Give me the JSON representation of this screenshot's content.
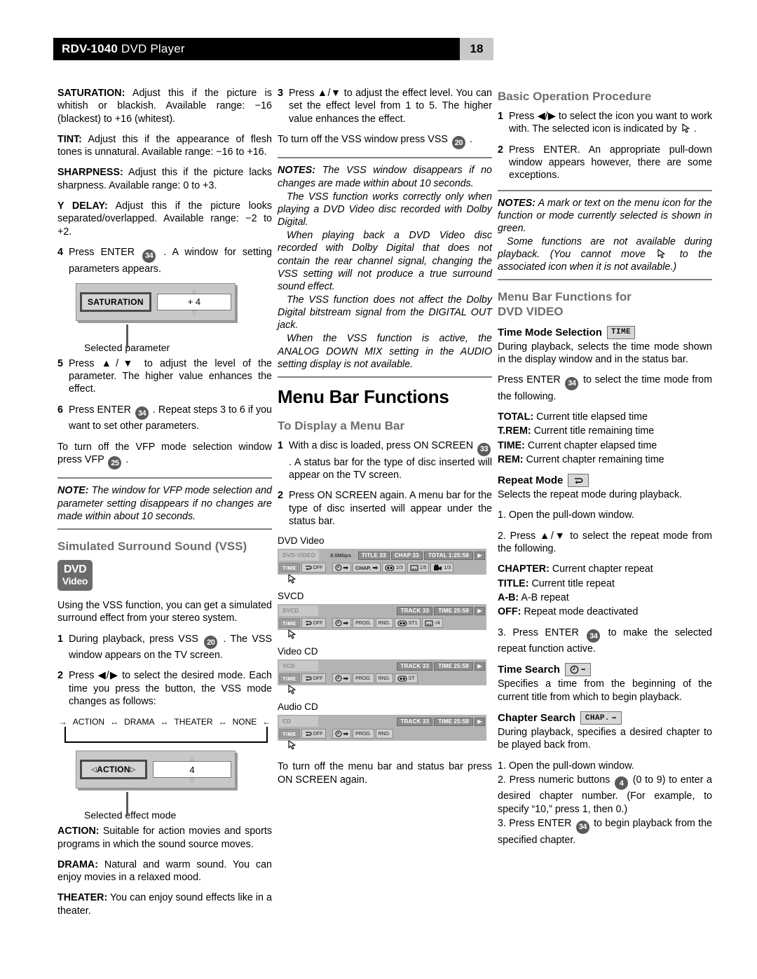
{
  "header": {
    "model": "RDV-1040",
    "product": " DVD Player",
    "page_number": "18"
  },
  "col1": {
    "saturation": {
      "term": "SATURATION:",
      "text": " Adjust this if the picture is whitish or blackish. Available range: −16 (blackest) to +16 (whitest)."
    },
    "tint": {
      "term": "TINT:",
      "text": " Adjust this if the appearance of flesh tones is unnatural. Available range: −16 to +16."
    },
    "sharpness": {
      "term": "SHARPNESS:",
      "text": " Adjust this if the picture lacks sharpness. Available range: 0 to +3."
    },
    "ydelay": {
      "term": "Y DELAY:",
      "text": " Adjust this if the picture looks separated/overlapped. Available range: −2 to +2."
    },
    "step4": {
      "n": "4",
      "pre": "Press ENTER ",
      "key": "34",
      "post": " . A window for setting parameters appears."
    },
    "param_window": {
      "label": "SATURATION",
      "value": "+ 4",
      "caption": "Selected parameter"
    },
    "step5": {
      "n": "5",
      "text": "Press ▲/▼ to adjust the level of the parameter. The higher value enhances the effect."
    },
    "step6": {
      "n": "6",
      "pre": "Press ENTER ",
      "key": "34",
      "post": " . Repeat steps 3 to 6 if you want to set other parameters."
    },
    "vfp_off": {
      "pre": "To turn off the VFP mode selection window press VFP ",
      "key": "25",
      "post": " ."
    },
    "note": {
      "label": "NOTE:",
      "text": " The window for VFP mode selection and parameter setting disappears if no changes are made within about 10 seconds."
    },
    "heading": "Simulated Surround Sound (VSS)",
    "dvd_logo": {
      "line1": "DVD",
      "line2": "Video"
    },
    "intro": "Using the VSS function, you can get a simulated surround effect from your stereo system.",
    "step1": {
      "n": "1",
      "pre": "During playback, press VSS ",
      "key": "20",
      "post": " . The VSS window appears on the TV screen."
    },
    "step2": {
      "n": "2",
      "text": "Press ◀/▶ to select the desired mode. Each time you press the button, the VSS mode changes as follows:"
    },
    "cycle": [
      "ACTION",
      "DRAMA",
      "THEATER",
      "NONE"
    ],
    "effect_window": {
      "label": "ACTION",
      "value": "4",
      "caption": "Selected effect mode"
    },
    "action": {
      "term": "ACTION:",
      "text": " Suitable for action movies and sports programs in which the sound source moves."
    },
    "drama": {
      "term": "DRAMA:",
      "text": " Natural and warm sound. You can enjoy movies in a relaxed mood."
    },
    "theater": {
      "term": "THEATER:",
      "text": " You can enjoy sound effects like in a theater."
    }
  },
  "col2": {
    "step3": {
      "n": "3",
      "text": "Press ▲/▼ to adjust the effect level. You can set the effect level from 1 to 5. The higher value enhances the effect."
    },
    "vss_off": {
      "pre": "To turn off the VSS window press VSS ",
      "key": "20",
      "post": " ."
    },
    "notes": {
      "label": "NOTES:",
      "p1": " The VSS window disappears if no changes are made within about 10 seconds.",
      "p2": "The VSS function works correctly only when playing a DVD Video disc recorded with Dolby Digital.",
      "p3": "When playing back a DVD Video disc recorded with Dolby Digital that does not contain the rear channel signal, changing the VSS setting will not produce a true surround sound effect.",
      "p4": "The VSS function does not affect the Dolby Digital bitstream signal from the DIGITAL OUT jack.",
      "p5": "When the VSS function is active, the ANALOG DOWN MIX setting in the AUDIO setting display is not available."
    },
    "heading": "Menu Bar Functions",
    "subheading": "To Display a Menu Bar",
    "step1": {
      "n": "1",
      "pre": "With a disc is loaded, press ON SCREEN ",
      "key": "33",
      "post": " . A status bar for the type of disc inserted will appear on the TV screen."
    },
    "step2": {
      "n": "2",
      "text": "Press ON SCREEN again. A menu bar for the type of disc inserted will appear under the status bar."
    },
    "statusbars": [
      {
        "title": "DVD Video",
        "disc_type": "DVD-VIDEO",
        "bitrate": "8.5Mbps",
        "chips": [
          "TITLE 33",
          "CHAP 33",
          "TOTAL 1:25:58"
        ],
        "play_icon": "play-icon",
        "buttons": [
          {
            "icon": "time-icon",
            "label": "TIME",
            "active": true
          },
          {
            "icon": "repeat-icon",
            "label": "OFF"
          },
          {
            "icon": "time-search-icon",
            "label": ""
          },
          {
            "icon": "chapter-search-icon",
            "label": "CHAP."
          },
          {
            "icon": "audio-icon",
            "label": "1/3"
          },
          {
            "icon": "subtitle-icon",
            "label": "1/5"
          },
          {
            "icon": "angle-icon",
            "label": "1/3"
          }
        ]
      },
      {
        "title": "SVCD",
        "disc_type": "SVCD",
        "bitrate": "",
        "chips": [
          "TRACK 33",
          "TIME      25:58"
        ],
        "play_icon": "play-icon",
        "buttons": [
          {
            "icon": "time-icon",
            "label": "TIME",
            "active": true
          },
          {
            "icon": "repeat-icon",
            "label": "OFF"
          },
          {
            "icon": "time-search-icon",
            "label": ""
          },
          {
            "icon": "program-icon",
            "label": "PROG."
          },
          {
            "icon": "random-icon",
            "label": "RND."
          },
          {
            "icon": "audio-icon",
            "label": "ST1"
          },
          {
            "icon": "subtitle-icon",
            "label": "-/4"
          }
        ]
      },
      {
        "title": "Video CD",
        "disc_type": "VCD",
        "bitrate": "",
        "chips": [
          "TRACK 33",
          "TIME      25:58"
        ],
        "play_icon": "play-icon",
        "buttons": [
          {
            "icon": "time-icon",
            "label": "TIME",
            "active": true
          },
          {
            "icon": "repeat-icon",
            "label": "OFF"
          },
          {
            "icon": "time-search-icon",
            "label": ""
          },
          {
            "icon": "program-icon",
            "label": "PROG."
          },
          {
            "icon": "random-icon",
            "label": "RND."
          },
          {
            "icon": "audio-icon",
            "label": "ST"
          }
        ]
      },
      {
        "title": "Audio CD",
        "disc_type": "CD",
        "bitrate": "",
        "chips": [
          "TRACK 33",
          "TIME      25:58"
        ],
        "play_icon": "play-icon",
        "buttons": [
          {
            "icon": "time-icon",
            "label": "TIME",
            "active": true
          },
          {
            "icon": "repeat-icon",
            "label": "OFF"
          },
          {
            "icon": "time-search-icon",
            "label": ""
          },
          {
            "icon": "program-icon",
            "label": "PROG."
          },
          {
            "icon": "random-icon",
            "label": "RND."
          }
        ]
      }
    ],
    "menubar_off": "To turn off the menu bar and status bar press ON SCREEN again."
  },
  "col3": {
    "heading": "Basic Operation Procedure",
    "step1": {
      "n": "1",
      "text": "Press ◀/▶ to select the icon you want to work with. The selected icon is indicated by"
    },
    "step2": {
      "n": "2",
      "text": "Press ENTER. An appropriate pull-down window appears however, there are some exceptions."
    },
    "notes": {
      "label": "NOTES:",
      "p1": " A mark or text on the menu icon for the function or mode currently selected is shown in green.",
      "p2a": "Some functions are not available during playback. (You cannot move",
      "p2b": "to the associated icon when it is not available.)"
    },
    "heading2_line1": "Menu Bar Functions for",
    "heading2_line2": "DVD VIDEO",
    "time_mode": {
      "title": "Time Mode Selection",
      "chip": "TIME",
      "desc": "During playback, selects the time mode shown in the display window and in the status bar.",
      "press": {
        "pre": "Press ENTER ",
        "key": "34",
        "post": " to select the time mode from the following."
      },
      "modes": [
        {
          "term": "TOTAL:",
          "text": " Current title elapsed time"
        },
        {
          "term": "T.REM:",
          "text": " Current title remaining time"
        },
        {
          "term": "TIME:",
          "text": " Current chapter elapsed time"
        },
        {
          "term": "REM:",
          "text": " Current chapter remaining time"
        }
      ]
    },
    "repeat_mode": {
      "title": "Repeat Mode",
      "chip_icon": "repeat-icon",
      "desc": "Selects the repeat mode during playback.",
      "s1": "1. Open the pull-down window.",
      "s2": "2. Press ▲/▼ to select the repeat mode from the following.",
      "modes": [
        {
          "term": "CHAPTER:",
          "text": " Current chapter repeat"
        },
        {
          "term": "TITLE:",
          "text": " Current title repeat"
        },
        {
          "term": "A-B:",
          "text": " A-B repeat"
        },
        {
          "term": "OFF:",
          "text": " Repeat mode deactivated"
        }
      ],
      "s3": {
        "pre": "3. Press ENTER ",
        "key": "34",
        "post": " to make the selected repeat function active."
      }
    },
    "time_search": {
      "title": "Time Search",
      "chip_icon": "time-search-icon",
      "desc": "Specifies a time from the beginning of the current title from which to begin playback."
    },
    "chapter_search": {
      "title": "Chapter Search",
      "chip": "CHAP.",
      "desc": "During playback, specifies a desired chapter to be played back from.",
      "s1": "1. Open the pull-down window.",
      "s2": {
        "pre": "2. Press numeric buttons ",
        "key": "4",
        "post": " (0 to 9) to enter a desired chapter number. (For example, to specify “10,” press 1, then 0.)"
      },
      "s3": {
        "pre": "3. Press ENTER ",
        "key": "34",
        "post": " to begin playback from the specified chapter."
      }
    }
  },
  "colors": {
    "header_bg": "#000000",
    "page_badge_bg": "#c9c9c9",
    "subheading": "#6d6d6d",
    "rule": "#808080",
    "statusbar_bg": "#b3b3b3",
    "chip_bg": "#8d8d8d",
    "button_bg": "#cfcfcf"
  }
}
